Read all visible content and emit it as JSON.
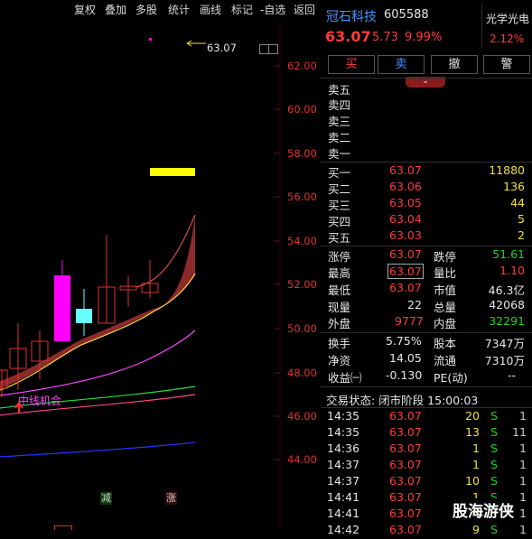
{
  "toolbar": {
    "items": [
      "复权",
      "叠加",
      "多股",
      "统计",
      "画线",
      "标记",
      "-自选",
      "返回"
    ]
  },
  "chart": {
    "price_labels": [
      "62.00",
      "60.00",
      "58.00",
      "56.00",
      "54.00",
      "52.00",
      "50.00",
      "48.00",
      "46.00",
      "44.00"
    ],
    "high_marker": "63.07",
    "annotation": "中线机会",
    "bottom_tag_left": "减",
    "bottom_tag_right": "涨",
    "colors": {
      "up": "#e03030",
      "bull_fill": "#ff00ff",
      "cyan": "#66ffff",
      "ma_yellow": "#ffff00",
      "ma_magenta": "#ff44ff",
      "ma_green": "#22dd44",
      "ma_pink": "#ff4488",
      "ma_blue": "#2233ff"
    }
  },
  "stock": {
    "name": "冠石科技",
    "code": "605588",
    "sector": "光学光电",
    "sector_change": "2.12%",
    "price": "63.07",
    "change": "5.73",
    "change_pct": "9.99%"
  },
  "actions": [
    "买",
    "卖",
    "撤",
    "警"
  ],
  "sell_orders": [
    {
      "label": "卖五",
      "price": "",
      "vol": ""
    },
    {
      "label": "卖四",
      "price": "",
      "vol": ""
    },
    {
      "label": "卖三",
      "price": "",
      "vol": ""
    },
    {
      "label": "卖二",
      "price": "",
      "vol": ""
    },
    {
      "label": "卖一",
      "price": "",
      "vol": ""
    }
  ],
  "buy_orders": [
    {
      "label": "买一",
      "price": "63.07",
      "vol": "11880"
    },
    {
      "label": "买二",
      "price": "63.06",
      "vol": "136"
    },
    {
      "label": "买三",
      "price": "63.05",
      "vol": "44"
    },
    {
      "label": "买四",
      "price": "63.04",
      "vol": "5"
    },
    {
      "label": "买五",
      "price": "63.03",
      "vol": "2"
    }
  ],
  "stats": {
    "zhangting_label": "涨停",
    "zhangting": "63.07",
    "dieting_label": "跌停",
    "dieting": "51.61",
    "high_label": "最高",
    "high": "63.07",
    "liangbi_label": "量比",
    "liangbi": "1.10",
    "low_label": "最低",
    "low": "63.07",
    "shizhi_label": "市值",
    "shizhi": "46.3亿",
    "xianliang_label": "现量",
    "xianliang": "22",
    "zongliang_label": "总量",
    "zongliang": "42068",
    "waipan_label": "外盘",
    "waipan": "9777",
    "neipan_label": "内盘",
    "neipan": "32291",
    "huanshou_label": "换手",
    "huanshou": "5.75%",
    "guben_label": "股本",
    "guben": "7347万",
    "jingzi_label": "净资",
    "jingzi": "14.05",
    "liutong_label": "流通",
    "liutong": "7310万",
    "shouyi_label": "收益㈠",
    "shouyi": "-0.130",
    "pe_label": "PE(动)",
    "pe": "--"
  },
  "trade_status": "交易状态: 闭市阶段 15:00:03",
  "ticks": [
    {
      "time": "14:35",
      "price": "63.07",
      "vol": "20",
      "side": "S",
      "n": "1"
    },
    {
      "time": "14:35",
      "price": "63.07",
      "vol": "13",
      "side": "S",
      "n": "11"
    },
    {
      "time": "14:36",
      "price": "63.07",
      "vol": "1",
      "side": "S",
      "n": "1"
    },
    {
      "time": "14:37",
      "price": "63.07",
      "vol": "1",
      "side": "S",
      "n": "1"
    },
    {
      "time": "14:37",
      "price": "63.07",
      "vol": "10",
      "side": "S",
      "n": "1"
    },
    {
      "time": "14:41",
      "price": "63.07",
      "vol": "1",
      "side": "S",
      "n": "1"
    },
    {
      "time": "14:41",
      "price": "63.07",
      "vol": "1",
      "side": "S",
      "n": "1"
    },
    {
      "time": "14:42",
      "price": "63.07",
      "vol": "9",
      "side": "S",
      "n": "1"
    }
  ],
  "watermark": "股海游侠"
}
